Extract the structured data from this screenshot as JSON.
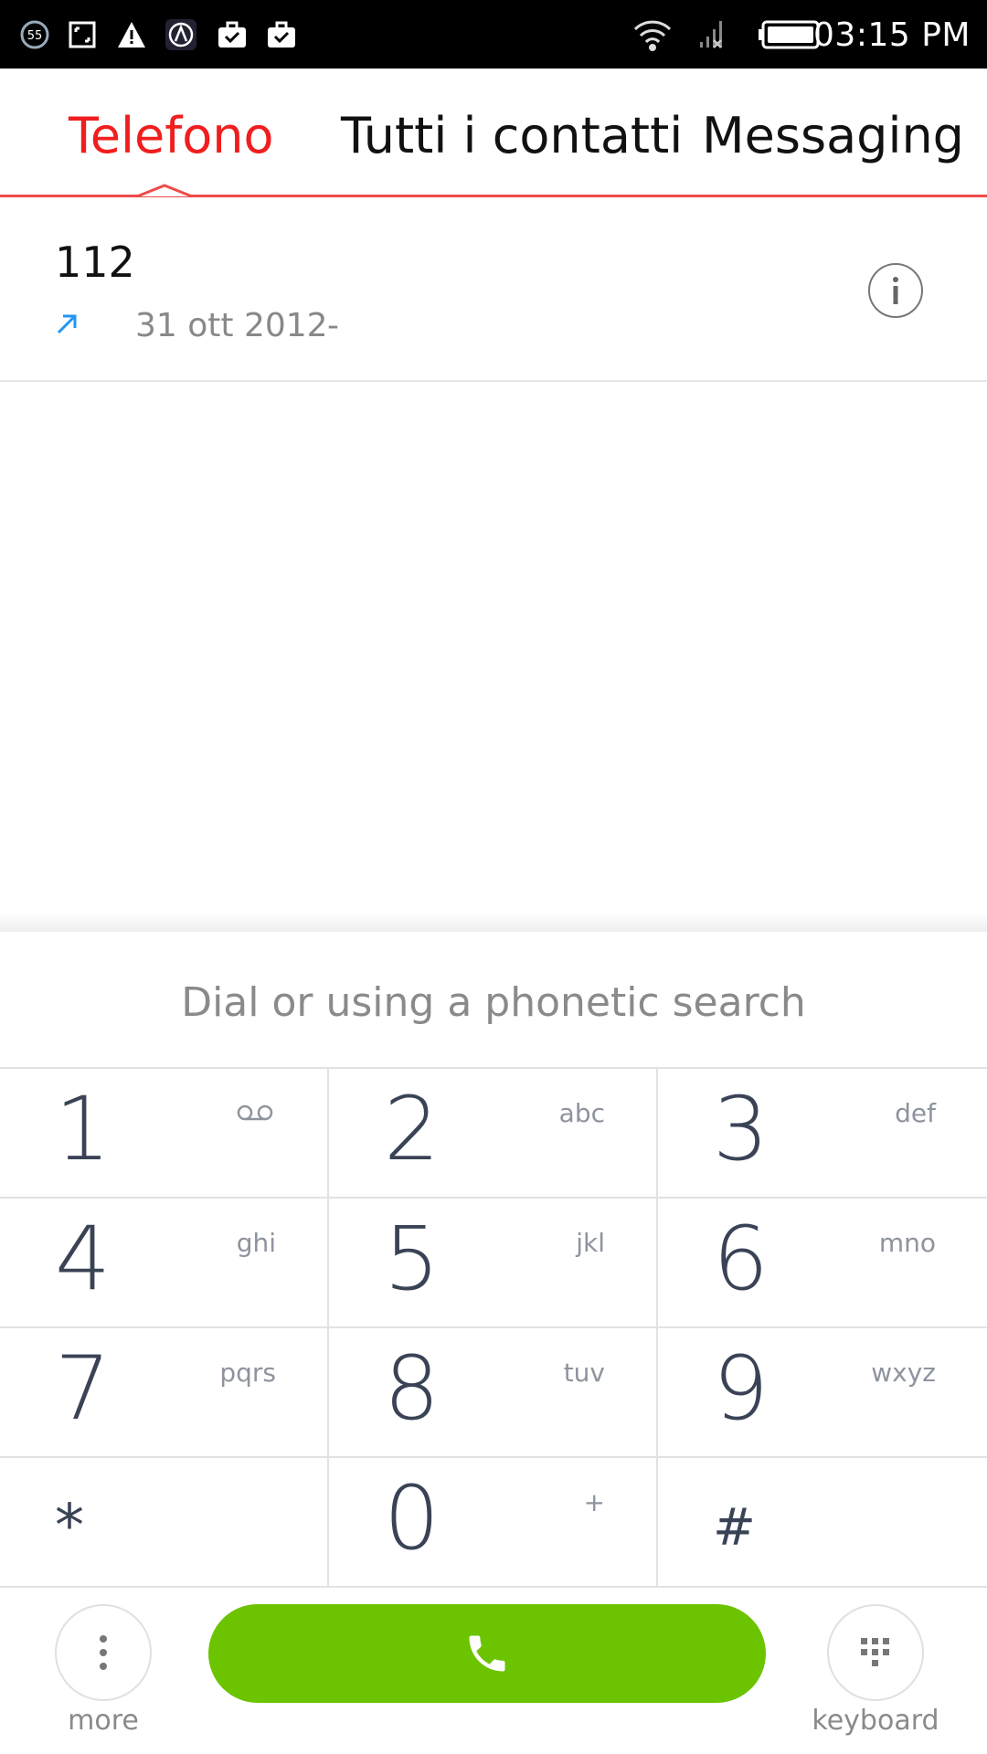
{
  "status_bar": {
    "notification_badge": "55",
    "time": "03:15 PM"
  },
  "tabs": [
    {
      "label": "Telefono",
      "active": true
    },
    {
      "label": "Tutti i contatti",
      "active": false
    },
    {
      "label": "Messaging",
      "active": false
    }
  ],
  "call_log": [
    {
      "number": "112",
      "date": "31 ott 2012",
      "duration": "-",
      "direction": "outgoing"
    }
  ],
  "dialer": {
    "placeholder": "Dial or using a phonetic search",
    "keys": [
      {
        "digit": "1",
        "letters": "",
        "voicemail": true
      },
      {
        "digit": "2",
        "letters": "abc"
      },
      {
        "digit": "3",
        "letters": "def"
      },
      {
        "digit": "4",
        "letters": "ghi"
      },
      {
        "digit": "5",
        "letters": "jkl"
      },
      {
        "digit": "6",
        "letters": "mno"
      },
      {
        "digit": "7",
        "letters": "pqrs"
      },
      {
        "digit": "8",
        "letters": "tuv"
      },
      {
        "digit": "9",
        "letters": "wxyz"
      },
      {
        "digit": "*",
        "letters": ""
      },
      {
        "digit": "0",
        "letters": "+"
      },
      {
        "digit": "#",
        "letters": ""
      }
    ]
  },
  "bottom_bar": {
    "more_label": "more",
    "keyboard_label": "keyboard"
  },
  "colors": {
    "accent": "#f01e1e",
    "call_button": "#6cc300",
    "arrow": "#2196f3"
  }
}
